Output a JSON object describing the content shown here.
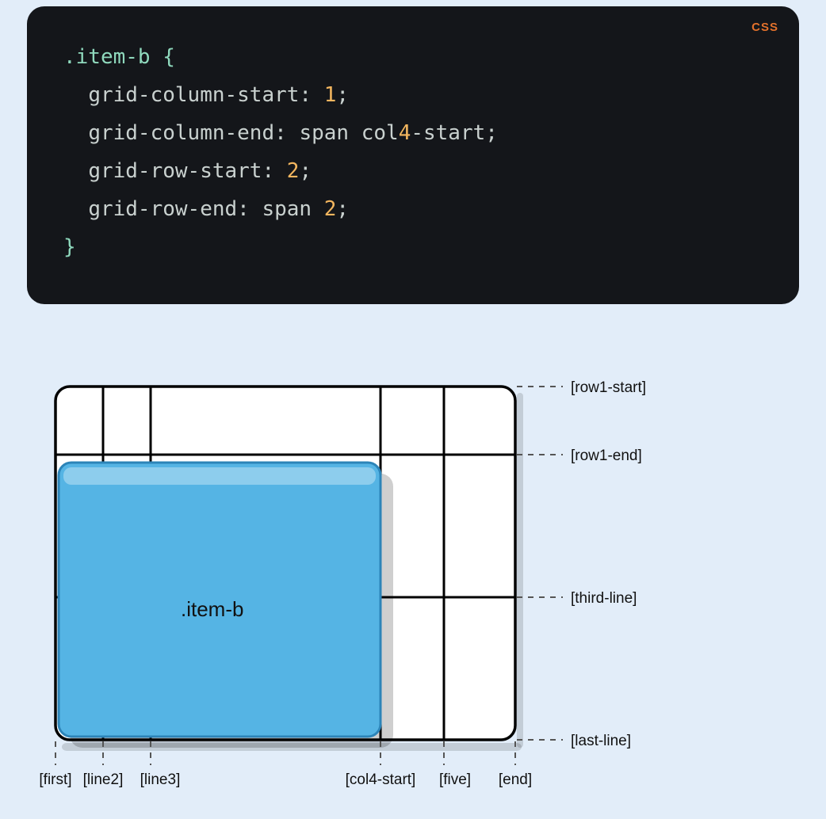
{
  "code": {
    "language": "CSS",
    "selector": ".item-b",
    "open_brace": "{",
    "close_brace": "}",
    "decls": [
      {
        "prop": "grid-column-start",
        "value_num": "1"
      },
      {
        "prop": "grid-column-end",
        "value_kw": "span",
        "value_ident_pre": "col",
        "value_ident_num": "4",
        "value_ident_post": "-start"
      },
      {
        "prop": "grid-row-start",
        "value_num": "2"
      },
      {
        "prop": "grid-row-end",
        "value_kw": "span",
        "value_num": "2"
      }
    ]
  },
  "diagram": {
    "item_label": ".item-b",
    "row_lines": [
      "[row1-start]",
      "[row1-end]",
      "[third-line]",
      "[last-line]"
    ],
    "col_lines": [
      "[first]",
      "[line2]",
      "[line3]",
      "[col4-start]",
      "[five]",
      "[end]"
    ],
    "item_span": {
      "col_start": 1,
      "col_end": 4,
      "row_start": 2,
      "row_end": 4
    }
  }
}
